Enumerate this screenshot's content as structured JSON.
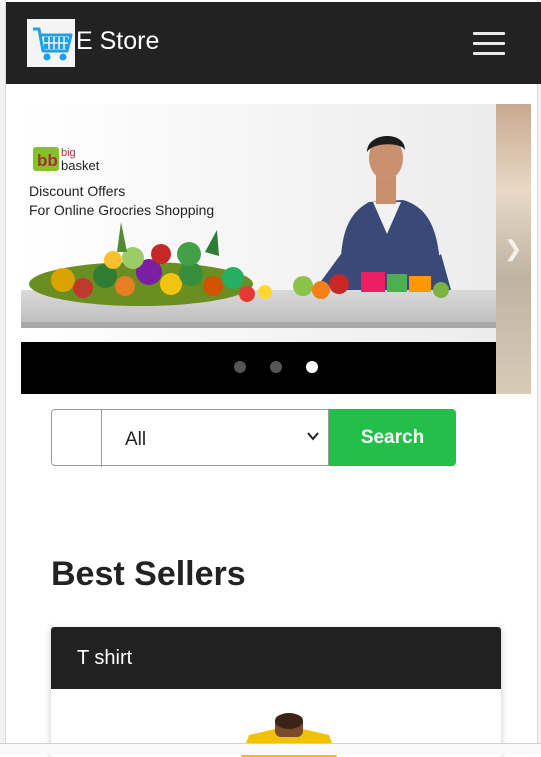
{
  "navbar": {
    "brand": "E Store",
    "logo_icon": "shopping-cart-icon",
    "menu_icon": "hamburger-menu-icon",
    "background": "#222222"
  },
  "carousel": {
    "banner_brand_line1": "big",
    "banner_brand_line2": "basket",
    "banner_line1": "Discount Offers",
    "banner_line2": "For Online Grocries Shopping",
    "slide_count": 3,
    "active_slide": 3
  },
  "search": {
    "category_selected": "All",
    "button_label": "Search",
    "button_color": "#22c04a"
  },
  "best_sellers": {
    "title": "Best Sellers",
    "products": [
      {
        "name": "T shirt"
      }
    ]
  }
}
